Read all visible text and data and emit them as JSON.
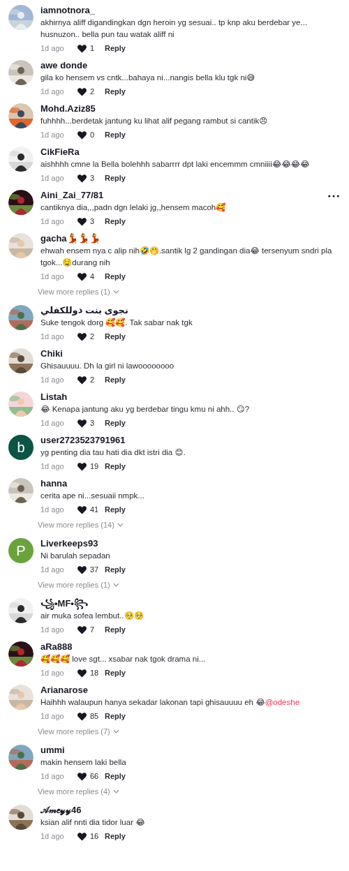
{
  "comments": [
    {
      "username": "iamnotnora_",
      "text": "akhirnya aliff digandingkan dgn heroin yg sesuai.. tp knp aku berdebar ye... husnuzon.. bella pun tau watak aliff ni",
      "time": "1d ago",
      "likes": "1",
      "reply": "Reply",
      "menu": false
    },
    {
      "username": "awe donde",
      "text": "gila ko hensem vs cntk...bahaya ni...nangis bella klu tgk ni😅",
      "time": "1d ago",
      "likes": "2",
      "reply": "Reply",
      "menu": false
    },
    {
      "username": "Mohd.Aziz85",
      "text": "fuhhhh...berdetak jantung ku lihat alif pegang rambut si cantik😠",
      "time": "1d ago",
      "likes": "0",
      "reply": "Reply",
      "menu": false
    },
    {
      "username": "CikFieRa",
      "text": "aishhhh cmne la Bella bolehhh sabarrrr dpt laki encemmm cmniiii😂😂😂😂",
      "time": "1d ago",
      "likes": "3",
      "reply": "Reply",
      "menu": false
    },
    {
      "username": "Aini_Zai_77/81",
      "text": "cantiknya dia,,,padn dgn lelaki jg,,hensem macoh🥰",
      "time": "1d ago",
      "likes": "3",
      "reply": "Reply",
      "menu": true
    },
    {
      "username": "gacha💃💃💃",
      "text": "ehwah ensem nya c alip nih🤣🤭.santik lg 2 gandingan dia😂 tersenyum sndri pla tgok...🤤durang nih",
      "time": "1d ago",
      "likes": "4",
      "reply": "Reply",
      "menu": false,
      "more_replies": "View more replies (1)"
    },
    {
      "username": "نجوى بنت ذوللكفلي",
      "text": "Suke tengok dorg 🥰🥰. Tak sabar nak tgk",
      "time": "1d ago",
      "likes": "2",
      "reply": "Reply",
      "menu": false
    },
    {
      "username": "Chiki",
      "text": "Ghisauuuu. Dh la girl ni lawoooooooo",
      "time": "1d ago",
      "likes": "2",
      "reply": "Reply",
      "menu": false
    },
    {
      "username": "Listah",
      "text": "😂 Kenapa jantung aku yg berdebar tingu kmu ni ahh.. 😏?",
      "time": "1d ago",
      "likes": "3",
      "reply": "Reply",
      "menu": false
    },
    {
      "avatar": {
        "kind": "letter",
        "letter": "b",
        "color": "#0c5443"
      },
      "username": "user2723523791961",
      "text": "yg penting dia tau hati dia dkt istri dia 😊.",
      "time": "1d ago",
      "likes": "19",
      "reply": "Reply",
      "menu": false
    },
    {
      "username": "hanna",
      "text": "cerita ape ni...sesuaii nmpk...",
      "time": "1d ago",
      "likes": "41",
      "reply": "Reply",
      "menu": false,
      "more_replies": "View more replies (14)"
    },
    {
      "avatar": {
        "kind": "letter",
        "letter": "P",
        "color": "#6aa33c"
      },
      "username": "Liverkeeps93",
      "text": "Ni barulah sepadan",
      "time": "1d ago",
      "likes": "37",
      "reply": "Reply",
      "menu": false,
      "more_replies": "View more replies (1)"
    },
    {
      "username": "꧁•MF•꧂",
      "text": "air muka sofea lembut..🥺🥺",
      "time": "1d ago",
      "likes": "7",
      "reply": "Reply",
      "menu": false
    },
    {
      "username": "aRa888",
      "text": "🥰🥰🥰 love sgt... xsabar nak tgok drama ni...",
      "time": "1d ago",
      "likes": "18",
      "reply": "Reply",
      "menu": false
    },
    {
      "username": "Arianarose",
      "text": "Haihhh walaupun hanya sekadar lakonan tapi ghisauuuu eh 😂",
      "mention": "@odeshe",
      "time": "1d ago",
      "likes": "85",
      "reply": "Reply",
      "menu": false,
      "more_replies": "View more replies (7)"
    },
    {
      "username": "ummi",
      "text": "makin hensem laki bella",
      "time": "1d ago",
      "likes": "66",
      "reply": "Reply",
      "menu": false,
      "more_replies": "View more replies (4)"
    },
    {
      "username": "𝒜𝓂𝑒𝓎𝓎46",
      "text": "ksian alif nnti dia tidor luar 😂",
      "time": "1d ago",
      "likes": "16",
      "reply": "Reply",
      "menu": false
    }
  ]
}
